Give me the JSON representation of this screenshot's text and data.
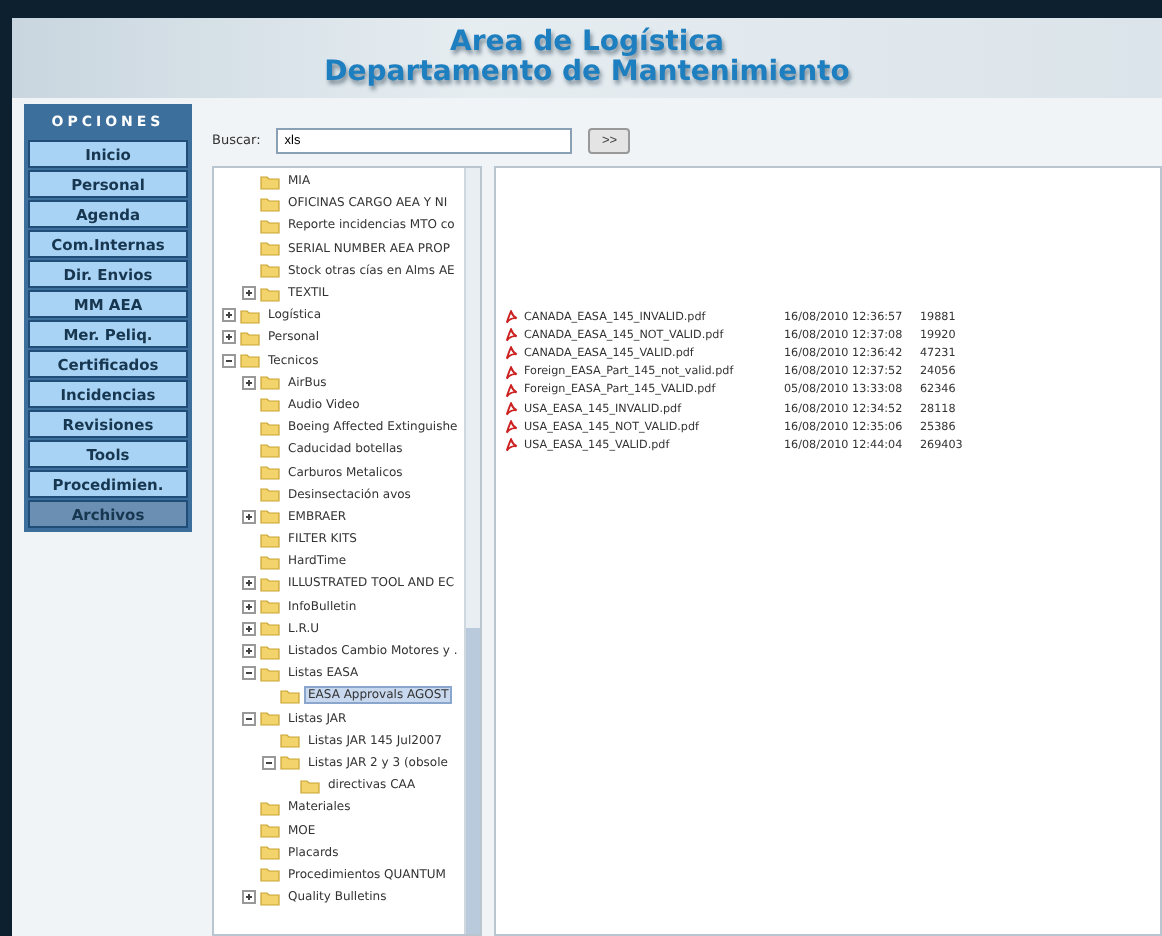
{
  "header": {
    "title": "Area de Logística",
    "subtitle": "Departamento de Mantenimiento"
  },
  "sidebar": {
    "heading": "OPCIONES",
    "items": [
      {
        "label": "Inicio",
        "selected": false
      },
      {
        "label": "Personal",
        "selected": false
      },
      {
        "label": "Agenda",
        "selected": false
      },
      {
        "label": "Com.Internas",
        "selected": false
      },
      {
        "label": "Dir. Envios",
        "selected": false
      },
      {
        "label": "MM AEA",
        "selected": false
      },
      {
        "label": "Mer. Peliq.",
        "selected": false
      },
      {
        "label": "Certificados",
        "selected": false
      },
      {
        "label": "Incidencias",
        "selected": false
      },
      {
        "label": "Revisiones",
        "selected": false
      },
      {
        "label": "Tools",
        "selected": false
      },
      {
        "label": "Procedimien.",
        "selected": false
      },
      {
        "label": "Archivos",
        "selected": true
      }
    ]
  },
  "search": {
    "label": "Buscar:",
    "value": "xls",
    "button": ">>"
  },
  "tree": {
    "continued_children": [
      {
        "label": "MIA",
        "selected": false
      },
      {
        "label": "OFICINAS CARGO AEA Y NI",
        "selected": false
      },
      {
        "label": "Reporte incidencias MTO co",
        "selected": false
      },
      {
        "label": "SERIAL NUMBER AEA PROP",
        "selected": false
      },
      {
        "label": "Stock otras cías en Alms AE",
        "selected": false
      },
      {
        "label": "TEXTIL",
        "expanded": false,
        "selected": false
      }
    ],
    "items": [
      {
        "label": "Logística",
        "expanded": false,
        "selected": false
      },
      {
        "label": "Personal",
        "expanded": false,
        "selected": false
      },
      {
        "label": "Tecnicos",
        "expanded": true,
        "selected": false,
        "children": [
          {
            "label": "AirBus",
            "expanded": false,
            "selected": false
          },
          {
            "label": "Audio Video",
            "selected": false
          },
          {
            "label": "Boeing Affected Extinguishe",
            "selected": false
          },
          {
            "label": "Caducidad botellas",
            "selected": false
          },
          {
            "label": "Carburos Metalicos",
            "selected": false
          },
          {
            "label": "Desinsectación avos",
            "selected": false
          },
          {
            "label": "EMBRAER",
            "expanded": false,
            "selected": false
          },
          {
            "label": "FILTER KITS",
            "selected": false
          },
          {
            "label": "HardTime",
            "selected": false
          },
          {
            "label": "ILLUSTRATED TOOL AND EC",
            "expanded": false,
            "selected": false
          },
          {
            "label": "InfoBulletin",
            "expanded": false,
            "selected": false
          },
          {
            "label": "L.R.U",
            "expanded": false,
            "selected": false
          },
          {
            "label": "Listados Cambio Motores y .",
            "expanded": false,
            "selected": false
          },
          {
            "label": "Listas EASA",
            "expanded": true,
            "selected": false,
            "children": [
              {
                "label": "EASA Approvals AGOST",
                "selected": true
              }
            ]
          },
          {
            "label": "Listas JAR",
            "expanded": true,
            "selected": false,
            "children": [
              {
                "label": "Listas JAR 145 Jul2007",
                "selected": false
              },
              {
                "label": "Listas JAR 2 y 3 (obsole",
                "expanded": true,
                "selected": false,
                "children": [
                  {
                    "label": "directivas CAA",
                    "selected": false
                  }
                ]
              }
            ]
          },
          {
            "label": "Materiales",
            "selected": false
          },
          {
            "label": "MOE",
            "selected": false
          },
          {
            "label": "Placards",
            "selected": false
          },
          {
            "label": "Procedimientos QUANTUM",
            "selected": false
          },
          {
            "label": "Quality Bulletins",
            "expanded": false,
            "selected": false
          }
        ]
      }
    ]
  },
  "files": [
    {
      "name": "CANADA_EASA_145_INVALID.pdf",
      "date": "16/08/2010 12:36:57",
      "size": "19881"
    },
    {
      "name": "CANADA_EASA_145_NOT_VALID.pdf",
      "date": "16/08/2010 12:37:08",
      "size": "19920"
    },
    {
      "name": "CANADA_EASA_145_VALID.pdf",
      "date": "16/08/2010 12:36:42",
      "size": "47231"
    },
    {
      "name": "Foreign_EASA_Part_145_not_valid.pdf",
      "date": "16/08/2010 12:37:52",
      "size": "24056"
    },
    {
      "name": "Foreign_EASA_Part_145_VALID.pdf",
      "date": "05/08/2010 13:33:08",
      "size": "62346"
    },
    {
      "name": "USA_EASA_145_INVALID.pdf",
      "date": "16/08/2010 12:34:52",
      "size": "28118"
    },
    {
      "name": "USA_EASA_145_NOT_VALID.pdf",
      "date": "16/08/2010 12:35:06",
      "size": "25386"
    },
    {
      "name": "USA_EASA_145_VALID.pdf",
      "date": "16/08/2010 12:44:04",
      "size": "269403"
    }
  ]
}
